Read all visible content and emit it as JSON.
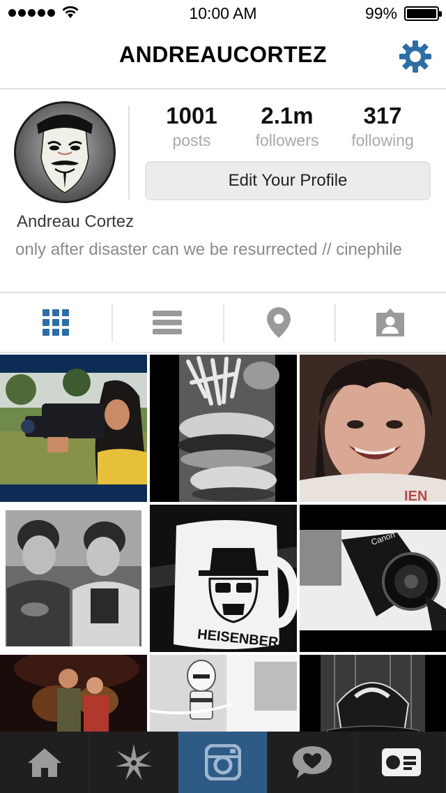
{
  "status_bar": {
    "time": "10:00 AM",
    "battery": "99%",
    "battery_level": 0.99,
    "icons": [
      "signal-dots",
      "wifi-icon",
      "battery-icon"
    ]
  },
  "header": {
    "title": "ANDREAUCORTEZ",
    "settings_icon": "gear-icon",
    "accent": "#2d6ea5"
  },
  "profile": {
    "stats": {
      "posts_count": "1001",
      "posts_label": "posts",
      "followers_count": "2.1m",
      "followers_label": "followers",
      "following_count": "317",
      "following_label": "following"
    },
    "edit_button": "Edit Your Profile",
    "full_name": "Andreau Cortez",
    "bio": "only after disaster can we be resurrected  // cinephile"
  },
  "tabs": [
    {
      "icon": "grid-icon",
      "selected": true
    },
    {
      "icon": "list-icon",
      "selected": false
    },
    {
      "icon": "map-pin-icon",
      "selected": false
    },
    {
      "icon": "tagged-photos-icon",
      "selected": false
    }
  ],
  "photos": [
    "woman-with-camera-photo",
    "fries-and-burger-photo",
    "smiling-girl-photo",
    "two-young-men-photo",
    "heisenberg-mug-photo",
    "canon-camera-photo",
    "movie-still-photo",
    "stormtrooper-toy-photo",
    "darth-vader-cap-photo"
  ],
  "bottom_nav": [
    {
      "icon": "home-icon",
      "active": false
    },
    {
      "icon": "explore-icon",
      "active": false
    },
    {
      "icon": "camera-icon",
      "active": true
    },
    {
      "icon": "news-heart-icon",
      "active": false
    },
    {
      "icon": "profile-card-icon",
      "active": false
    }
  ]
}
